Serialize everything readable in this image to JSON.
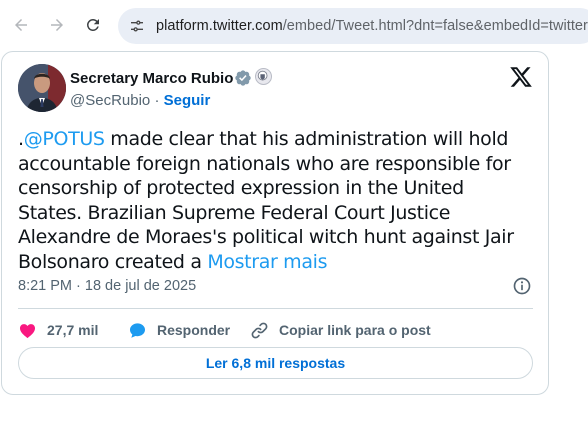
{
  "browser": {
    "url_domain": "platform.twitter.com",
    "url_path": "/embed/Tweet.html?dnt=false&embedId=twitter-"
  },
  "tweet": {
    "author_name": "Secretary Marco Rubio",
    "handle": "@SecRubio",
    "separator": "·",
    "follow_label": "Seguir",
    "text_prefix": ".",
    "mention": "@POTUS",
    "text_body": " made clear that his administration will hold accountable foreign nationals who are responsible for censorship of protected expression in the United States. Brazilian Supreme Federal Court Justice Alexandre de Moraes's political witch hunt against Jair Bolsonaro created a ",
    "show_more_label": "Mostrar mais",
    "timestamp": "8:21 PM · 18 de jul de 2025",
    "likes_count": "27,7 mil",
    "reply_label": "Responder",
    "copy_link_label": "Copiar link para o post",
    "read_replies_label": "Ler 6,8 mil respostas"
  },
  "colors": {
    "link": "#1d9bf0",
    "follow": "#006fd6",
    "like": "#f91880",
    "reply": "#1d9bf0",
    "verified": "#829aab"
  },
  "icons": {
    "back": "arrow-left-icon",
    "forward": "arrow-right-icon",
    "reload": "reload-icon",
    "site_info": "tune-icon",
    "verified": "verified-badge-icon",
    "seal": "government-seal-icon",
    "logo": "x-logo-icon",
    "info": "info-icon",
    "like": "heart-icon",
    "reply": "speech-bubble-icon",
    "copy": "link-icon"
  }
}
